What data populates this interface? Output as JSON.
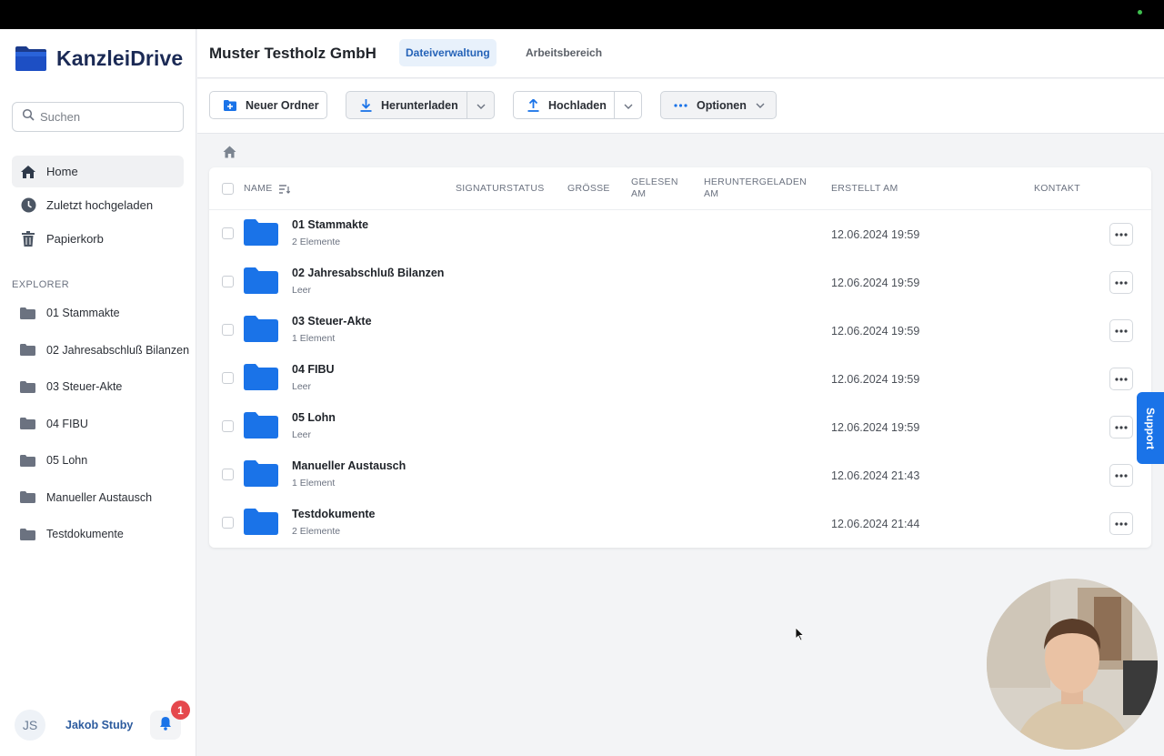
{
  "app": {
    "name": "KanzleiDrive"
  },
  "sidebar": {
    "search_placeholder": "Suchen",
    "nav": [
      {
        "label": "Home",
        "icon": "home-icon",
        "active": true
      },
      {
        "label": "Zuletzt hochgeladen",
        "icon": "clock-icon"
      },
      {
        "label": "Papierkorb",
        "icon": "trash-icon"
      }
    ],
    "explorer_title": "EXPLORER",
    "explorer": [
      "01 Stammakte",
      "02 Jahresabschluß Bilanzen",
      "03 Steuer-Akte",
      "04 FIBU",
      "05 Lohn",
      "Manueller Austausch",
      "Testdokumente"
    ],
    "user": {
      "initials": "JS",
      "name": "Jakob Stuby",
      "notifications": "1"
    }
  },
  "header": {
    "company": "Muster Testholz GmbH",
    "tabs": [
      {
        "label": "Dateiverwaltung",
        "active": true
      },
      {
        "label": "Arbeitsbereich",
        "active": false
      }
    ]
  },
  "toolbar": {
    "new_folder": "Neuer Ordner",
    "download": "Herunterladen",
    "upload": "Hochladen",
    "options": "Optionen"
  },
  "table": {
    "columns": {
      "name": "NAME",
      "signature": "SIGNATURSTATUS",
      "size": "GRÖSSE",
      "read_1": "GELESEN",
      "read_2": "AM",
      "downloaded_1": "HERUNTERGELADEN",
      "downloaded_2": "AM",
      "created": "ERSTELLT AM",
      "contact": "KONTAKT"
    },
    "rows": [
      {
        "name": "01 Stammakte",
        "sub": "2 Elemente",
        "created": "12.06.2024 19:59"
      },
      {
        "name": "02 Jahresabschluß Bilanzen",
        "sub": "Leer",
        "created": "12.06.2024 19:59"
      },
      {
        "name": "03 Steuer-Akte",
        "sub": "1 Element",
        "created": "12.06.2024 19:59"
      },
      {
        "name": "04 FIBU",
        "sub": "Leer",
        "created": "12.06.2024 19:59"
      },
      {
        "name": "05 Lohn",
        "sub": "Leer",
        "created": "12.06.2024 19:59"
      },
      {
        "name": "Manueller Austausch",
        "sub": "1 Element",
        "created": "12.06.2024 21:43"
      },
      {
        "name": "Testdokumente",
        "sub": "2 Elemente",
        "created": "12.06.2024 21:44"
      }
    ]
  },
  "support": {
    "label": "Support"
  },
  "colors": {
    "accent": "#1a73e8",
    "folder": "#1a73e8",
    "brand_text": "#1b2a55",
    "badge": "#e5484d"
  }
}
